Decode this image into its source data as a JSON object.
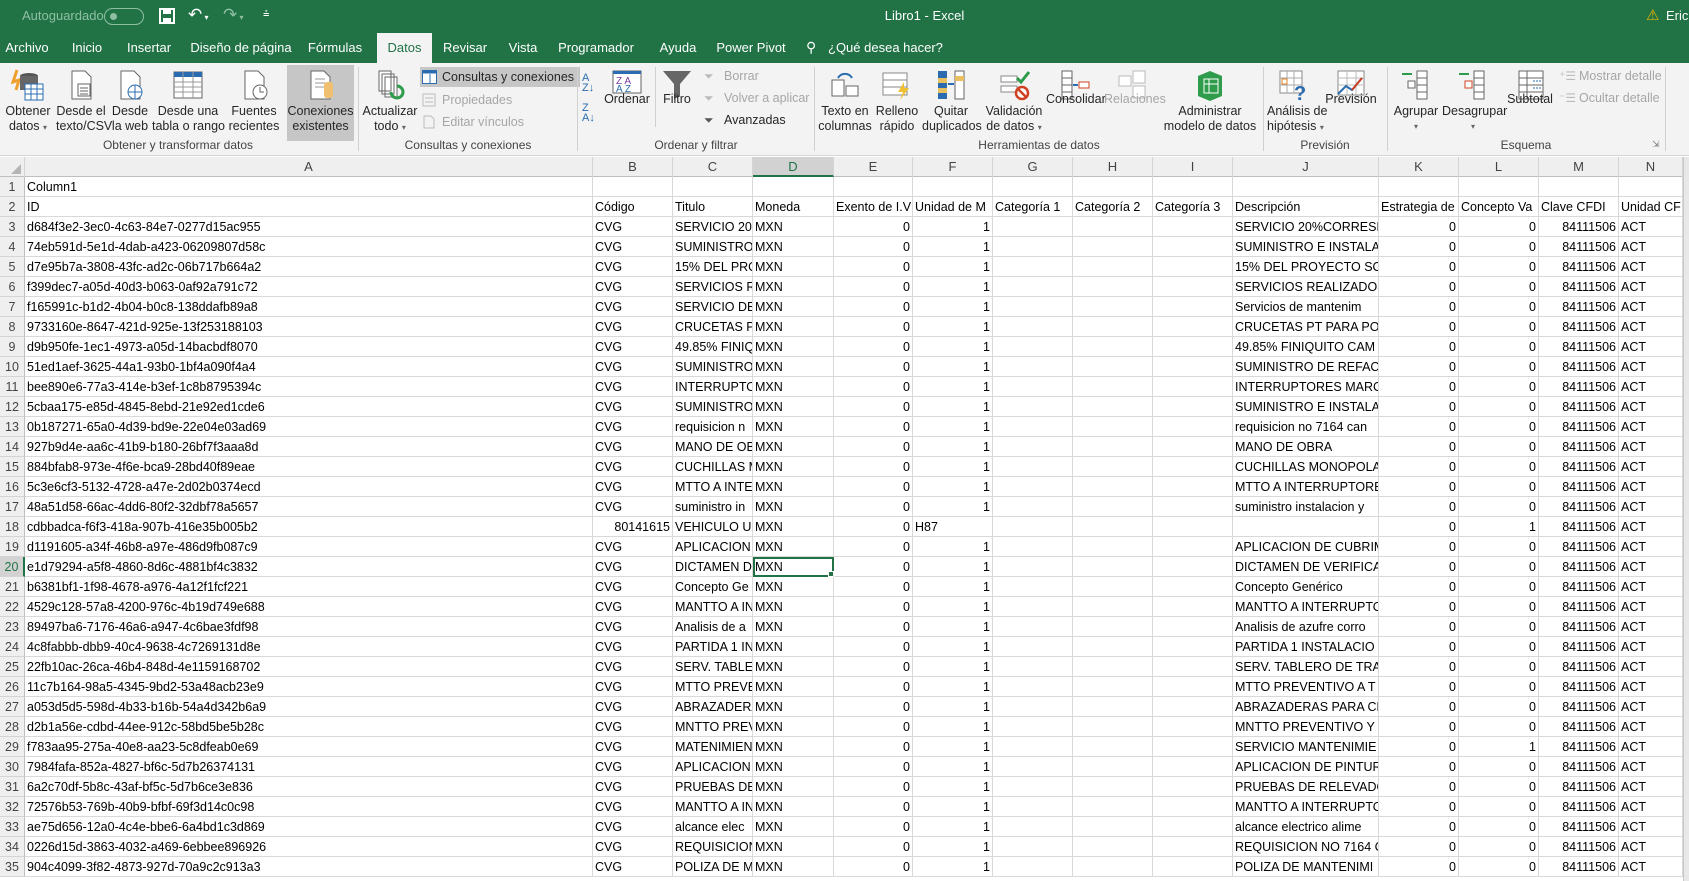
{
  "titlebar": {
    "autosave_label": "Autoguardado",
    "title": "Libro1  -  Excel",
    "user": "Eric",
    "brand_color": "#217346"
  },
  "tabs": [
    "Archivo",
    "Inicio",
    "Insertar",
    "Diseño de página",
    "Fórmulas",
    "Datos",
    "Revisar",
    "Vista",
    "Programador",
    "Ayuda",
    "Power Pivot"
  ],
  "active_tab": "Datos",
  "search_label": "¿Qué desea hacer?",
  "ribbon": {
    "groups": [
      "Obtener y transformar datos",
      "Consultas y conexiones",
      "Ordenar y filtrar",
      "Herramientas de datos",
      "Previsión",
      "Esquema"
    ],
    "obtener_datos": [
      "Obtener",
      "datos"
    ],
    "desde_texto": [
      "Desde el",
      "texto/CSV"
    ],
    "desde_web": [
      "Desde",
      "la web"
    ],
    "desde_tabla": [
      "Desde una",
      "tabla o rango"
    ],
    "fuentes": [
      "Fuentes",
      "recientes"
    ],
    "conexiones": [
      "Conexiones",
      "existentes"
    ],
    "actualizar": [
      "Actualizar",
      "todo"
    ],
    "consultas": "Consultas y conexiones",
    "propiedades": "Propiedades",
    "editar_vinculos": "Editar vínculos",
    "ordenar": "Ordenar",
    "filtro": "Filtro",
    "borrar": "Borrar",
    "volver": "Volver a aplicar",
    "avanzadas": "Avanzadas",
    "texto_columnas": [
      "Texto en",
      "columnas"
    ],
    "relleno": [
      "Relleno",
      "rápido"
    ],
    "quitar": [
      "Quitar",
      "duplicados"
    ],
    "validacion": [
      "Validación",
      "de datos"
    ],
    "consolidar": "Consolidar",
    "relaciones": "Relaciones",
    "administrar": [
      "Administrar",
      "modelo de datos"
    ],
    "analisis": [
      "Análisis de",
      "hipótesis"
    ],
    "prevision": "Previsión",
    "agrupar": "Agrupar",
    "desagrupar": "Desagrupar",
    "subtotal": "Subtotal",
    "mostrar": "Mostrar detalle",
    "ocultar": "Ocultar detalle"
  },
  "sheet": {
    "columns": [
      "A",
      "B",
      "C",
      "D",
      "E",
      "F",
      "G",
      "H",
      "I",
      "J",
      "K",
      "L",
      "M",
      "N"
    ],
    "selected_cell": "D20",
    "rows": [
      [
        "Column1",
        "",
        "",
        "",
        "",
        "",
        "",
        "",
        "",
        "",
        "",
        "",
        "",
        ""
      ],
      [
        "ID",
        "Código",
        "Titulo",
        "Moneda",
        "Exento de I.V",
        "Unidad de M",
        "Categoría 1",
        "Categoría 2",
        "Categoría 3",
        "Descripción",
        "Estrategia de",
        "Concepto Va",
        "Clave CFDI",
        "Unidad CF"
      ],
      [
        "d684f3e2-3ec0-4c63-84e7-0277d15ac955",
        "CVG",
        "SERVICIO 20%",
        "MXN",
        "0",
        "1",
        "",
        "",
        "",
        "SERVICIO 20%CORRESP",
        "0",
        "0",
        "84111506",
        "ACT"
      ],
      [
        "74eb591d-5e1d-4dab-a423-06209807d58c",
        "CVG",
        "SUMINISTRO",
        "MXN",
        "0",
        "1",
        "",
        "",
        "",
        "SUMINISTRO E INSTALA",
        "0",
        "0",
        "84111506",
        "ACT"
      ],
      [
        "d7e95b7a-3808-43fc-ad2c-06b717b664a2",
        "CVG",
        "15% DEL PRO",
        "MXN",
        "0",
        "1",
        "",
        "",
        "",
        "15% DEL PROYECTO  SO",
        "0",
        "0",
        "84111506",
        "ACT"
      ],
      [
        "f399dec7-a05d-40d3-b063-0af92a791c72",
        "CVG",
        "SERVICIOS RE",
        "MXN",
        "0",
        "1",
        "",
        "",
        "",
        "SERVICIOS REALIZADOS",
        "0",
        "0",
        "84111506",
        "ACT"
      ],
      [
        "f165991c-b1d2-4b04-b0c8-138ddafb89a8",
        "CVG",
        "SERVICIO DE",
        "MXN",
        "0",
        "1",
        "",
        "",
        "",
        "Servicios de mantenim",
        "0",
        "0",
        "84111506",
        "ACT"
      ],
      [
        "9733160e-8647-421d-925e-13f253188103",
        "CVG",
        "CRUCETAS PT",
        "MXN",
        "0",
        "1",
        "",
        "",
        "",
        "CRUCETAS PT PARA POS",
        "0",
        "0",
        "84111506",
        "ACT"
      ],
      [
        "d9b950fe-1ec1-4973-a05d-14bacbdf8070",
        "CVG",
        "49.85% FINIQ",
        "MXN",
        "0",
        "1",
        "",
        "",
        "",
        "49.85% FINIQUITO CAM",
        "0",
        "0",
        "84111506",
        "ACT"
      ],
      [
        "51ed1aef-3625-44a1-93b0-1bf4a090f4a4",
        "CVG",
        "SUMINISTRO",
        "MXN",
        "0",
        "1",
        "",
        "",
        "",
        "SUMINISTRO DE REFACC",
        "0",
        "0",
        "84111506",
        "ACT"
      ],
      [
        "bee890e6-77a3-414e-b3ef-1c8b8795394c",
        "CVG",
        "INTERRUPTO",
        "MXN",
        "0",
        "1",
        "",
        "",
        "",
        "INTERRUPTORES MARCA",
        "0",
        "0",
        "84111506",
        "ACT"
      ],
      [
        "5cbaa175-e85d-4845-8ebd-21e92ed1cde6",
        "CVG",
        "SUMINISTRO",
        "MXN",
        "0",
        "1",
        "",
        "",
        "",
        "SUMINISTRO E INSTALA",
        "0",
        "0",
        "84111506",
        "ACT"
      ],
      [
        "0b187271-65a0-4d39-bd9e-22e04e03ad69",
        "CVG",
        "requisicion n",
        "MXN",
        "0",
        "1",
        "",
        "",
        "",
        "requisicion no 7164 can",
        "0",
        "0",
        "84111506",
        "ACT"
      ],
      [
        "927b9d4e-aa6c-41b9-b180-26bf7f3aaa8d",
        "CVG",
        "MANO DE OB",
        "MXN",
        "0",
        "1",
        "",
        "",
        "",
        "MANO DE OBRA",
        "0",
        "0",
        "84111506",
        "ACT"
      ],
      [
        "884bfab8-973e-4f6e-bca9-28bd40f89eae",
        "CVG",
        "CUCHILLAS M",
        "MXN",
        "0",
        "1",
        "",
        "",
        "",
        "CUCHILLAS MONOPOLA",
        "0",
        "0",
        "84111506",
        "ACT"
      ],
      [
        "5c3e6cf3-5132-4728-a47e-2d02b0374ecd",
        "CVG",
        "MTTO A INTE",
        "MXN",
        "0",
        "1",
        "",
        "",
        "",
        "MTTO A INTERRUPTORE",
        "0",
        "0",
        "84111506",
        "ACT"
      ],
      [
        "48a51d58-66ac-4dd6-80f2-32dbf78a5657",
        "CVG",
        "suministro in",
        "MXN",
        "0",
        "1",
        "",
        "",
        "",
        "suministro instalacion y",
        "0",
        "0",
        "84111506",
        "ACT"
      ],
      [
        "cdbbadca-f6f3-418a-907b-416e35b005b2",
        "80141615",
        "VEHICULO US",
        "MXN",
        "0",
        "H87",
        "",
        "",
        "",
        "",
        "0",
        "1",
        "84111506",
        "ACT"
      ],
      [
        "d1191605-a34f-46b8-a97e-486d9fb087c9",
        "CVG",
        "APLICACION",
        "MXN",
        "0",
        "1",
        "",
        "",
        "",
        "APLICACION DE CUBRIM",
        "0",
        "0",
        "84111506",
        "ACT"
      ],
      [
        "e1d79294-a5f8-4860-8d6c-4881bf4c3832",
        "CVG",
        "DICTAMEN D",
        "MXN",
        "0",
        "1",
        "",
        "",
        "",
        "DICTAMEN DE VERIFICA",
        "0",
        "0",
        "84111506",
        "ACT"
      ],
      [
        "b6381bf1-1f98-4678-a976-4a12f1fcf221",
        "CVG",
        "Concepto Ge",
        "MXN",
        "0",
        "1",
        "",
        "",
        "",
        "Concepto Genérico",
        "0",
        "0",
        "84111506",
        "ACT"
      ],
      [
        "4529c128-57a8-4200-976c-4b19d749e688",
        "CVG",
        "MANTTO A IN",
        "MXN",
        "0",
        "1",
        "",
        "",
        "",
        "MANTTO A INTERRUPTO",
        "0",
        "0",
        "84111506",
        "ACT"
      ],
      [
        "89497ba6-7176-46a6-a947-4c6bae3fdf98",
        "CVG",
        "Analisis de a",
        "MXN",
        "0",
        "1",
        "",
        "",
        "",
        "Analisis de azufre corro",
        "0",
        "0",
        "84111506",
        "ACT"
      ],
      [
        "4c8fabbb-dbb9-40c4-9638-4c7269131d8e",
        "CVG",
        "PARTIDA 1 IN",
        "MXN",
        "0",
        "1",
        "",
        "",
        "",
        "PARTIDA 1 INSTALACIO",
        "0",
        "0",
        "84111506",
        "ACT"
      ],
      [
        "22fb10ac-26ca-46b4-848d-4e1159168702",
        "CVG",
        "SERV. TABLER",
        "MXN",
        "0",
        "1",
        "",
        "",
        "",
        "SERV. TABLERO DE TRAN",
        "0",
        "0",
        "84111506",
        "ACT"
      ],
      [
        "11c7b164-98a5-4345-9bd2-53a48acb23e9",
        "CVG",
        "MTTO PREVE",
        "MXN",
        "0",
        "1",
        "",
        "",
        "",
        "MTTO PREVENTIVO A  T",
        "0",
        "0",
        "84111506",
        "ACT"
      ],
      [
        "a053d5d5-598d-4b33-b16b-54a4d342b6a9",
        "CVG",
        "ABRAZADERA",
        "MXN",
        "0",
        "1",
        "",
        "",
        "",
        "ABRAZADERAS PARA CR",
        "0",
        "0",
        "84111506",
        "ACT"
      ],
      [
        "d2b1a56e-cdbd-44ee-912c-58bd5be5b28c",
        "CVG",
        "MNTTO PREV",
        "MXN",
        "0",
        "1",
        "",
        "",
        "",
        "MNTTO PREVENTIVO Y",
        "0",
        "0",
        "84111506",
        "ACT"
      ],
      [
        "f783aa95-275a-40e8-aa23-5c8dfeab0e69",
        "CVG",
        "MATENIMIEN",
        "MXN",
        "0",
        "1",
        "",
        "",
        "",
        "SERVICIO MANTENIMIE",
        "0",
        "1",
        "84111506",
        "ACT"
      ],
      [
        "7984fafa-852a-4827-bf6c-5d7b26374131",
        "CVG",
        "APLICACION",
        "MXN",
        "0",
        "1",
        "",
        "",
        "",
        "APLICACION DE PINTUR",
        "0",
        "0",
        "84111506",
        "ACT"
      ],
      [
        "6a2c70df-5b8c-43af-bf5c-5d7b6ce3e836",
        "CVG",
        "PRUEBAS DE",
        "MXN",
        "0",
        "1",
        "",
        "",
        "",
        "PRUEBAS DE RELEVADO",
        "0",
        "0",
        "84111506",
        "ACT"
      ],
      [
        "72576b53-769b-40b9-bfbf-69f3d14c0c98",
        "CVG",
        "MANTTO A IN",
        "MXN",
        "0",
        "1",
        "",
        "",
        "",
        "MANTTO A INTERRUPTO",
        "0",
        "0",
        "84111506",
        "ACT"
      ],
      [
        "ae75d656-12a0-4c4e-bbe6-6a4bd1c3d869",
        "CVG",
        "alcance elec",
        "MXN",
        "0",
        "1",
        "",
        "",
        "",
        "alcance electrico alime",
        "0",
        "0",
        "84111506",
        "ACT"
      ],
      [
        "0226d15d-3863-4032-a469-6ebbee896926",
        "CVG",
        "REQUISICION",
        "MXN",
        "0",
        "1",
        "",
        "",
        "",
        "REQUISICION NO 7164 C",
        "0",
        "0",
        "84111506",
        "ACT"
      ],
      [
        "904c4099-3f82-4873-927d-70a9c2c913a3",
        "CVG",
        "POLIZA DE M",
        "MXN",
        "0",
        "1",
        "",
        "",
        "",
        "POLIZA DE MANTENIMI",
        "0",
        "0",
        "84111506",
        "ACT"
      ]
    ]
  }
}
